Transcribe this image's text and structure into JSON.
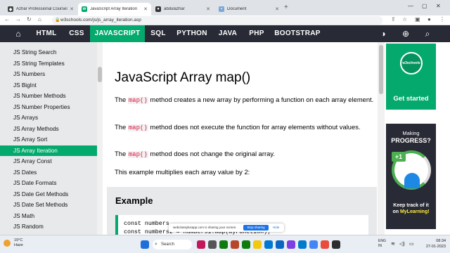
{
  "browser": {
    "tabs": [
      {
        "label": "Azhar Professional Courses |",
        "active": false
      },
      {
        "label": "JavaScript Array Iteration",
        "active": true
      },
      {
        "label": "abdulazhar",
        "active": false
      },
      {
        "label": "Document",
        "active": false
      }
    ],
    "url": "w3schools.com/js/js_array_iteration.asp"
  },
  "topnav": {
    "items": [
      "HTML",
      "CSS",
      "JAVASCRIPT",
      "SQL",
      "PYTHON",
      "JAVA",
      "PHP",
      "BOOTSTRAP"
    ],
    "active": "JAVASCRIPT"
  },
  "sidebar": {
    "items": [
      "JS String Search",
      "JS String Templates",
      "JS Numbers",
      "JS BigInt",
      "JS Number Methods",
      "JS Number Properties",
      "JS Arrays",
      "JS Array Methods",
      "JS Array Sort",
      "JS Array Iteration",
      "JS Array Const",
      "JS Dates",
      "JS Date Formats",
      "JS Date Get Methods",
      "JS Date Set Methods",
      "JS Math",
      "JS Random"
    ],
    "active_index": 9
  },
  "main": {
    "title": "JavaScript Array map()",
    "paragraphs": [
      {
        "pre": "The ",
        "code": "map()",
        "post": " method creates a new array by performing a function on each array element."
      },
      {
        "pre": "The ",
        "code": "map()",
        "post": " method does not execute the function for array elements without values."
      },
      {
        "pre": "The ",
        "code": "map()",
        "post": " method does not change the original array."
      }
    ],
    "intro": "This example multiplies each array value by 2:",
    "example": {
      "title": "Example",
      "code_line1": "const numbers",
      "code_line2": "const numbers2 = numbers1.map(myFunction);"
    }
  },
  "ads": {
    "ad1": {
      "badge": "w3schools",
      "cta": "Get started"
    },
    "ad2": {
      "small": "Making",
      "big": "PROGRESS?",
      "plus": "+1",
      "line1": "Keep track of it",
      "line2_pre": "on ",
      "line2_link": "MyLearning!"
    }
  },
  "sharebar": {
    "text": "webclassplusapp.com is sharing your screen.",
    "stop": "Stop sharing",
    "hide": "Hide"
  },
  "taskbar": {
    "weather_temp": "19°C",
    "weather_desc": "Haze",
    "search": "Search",
    "lang": "ENG",
    "region": "IN",
    "time": "08:34",
    "date": "27-01-2023"
  },
  "colors": {
    "accent": "#04aa6d",
    "dark": "#282a35",
    "code": "#dc143c"
  }
}
